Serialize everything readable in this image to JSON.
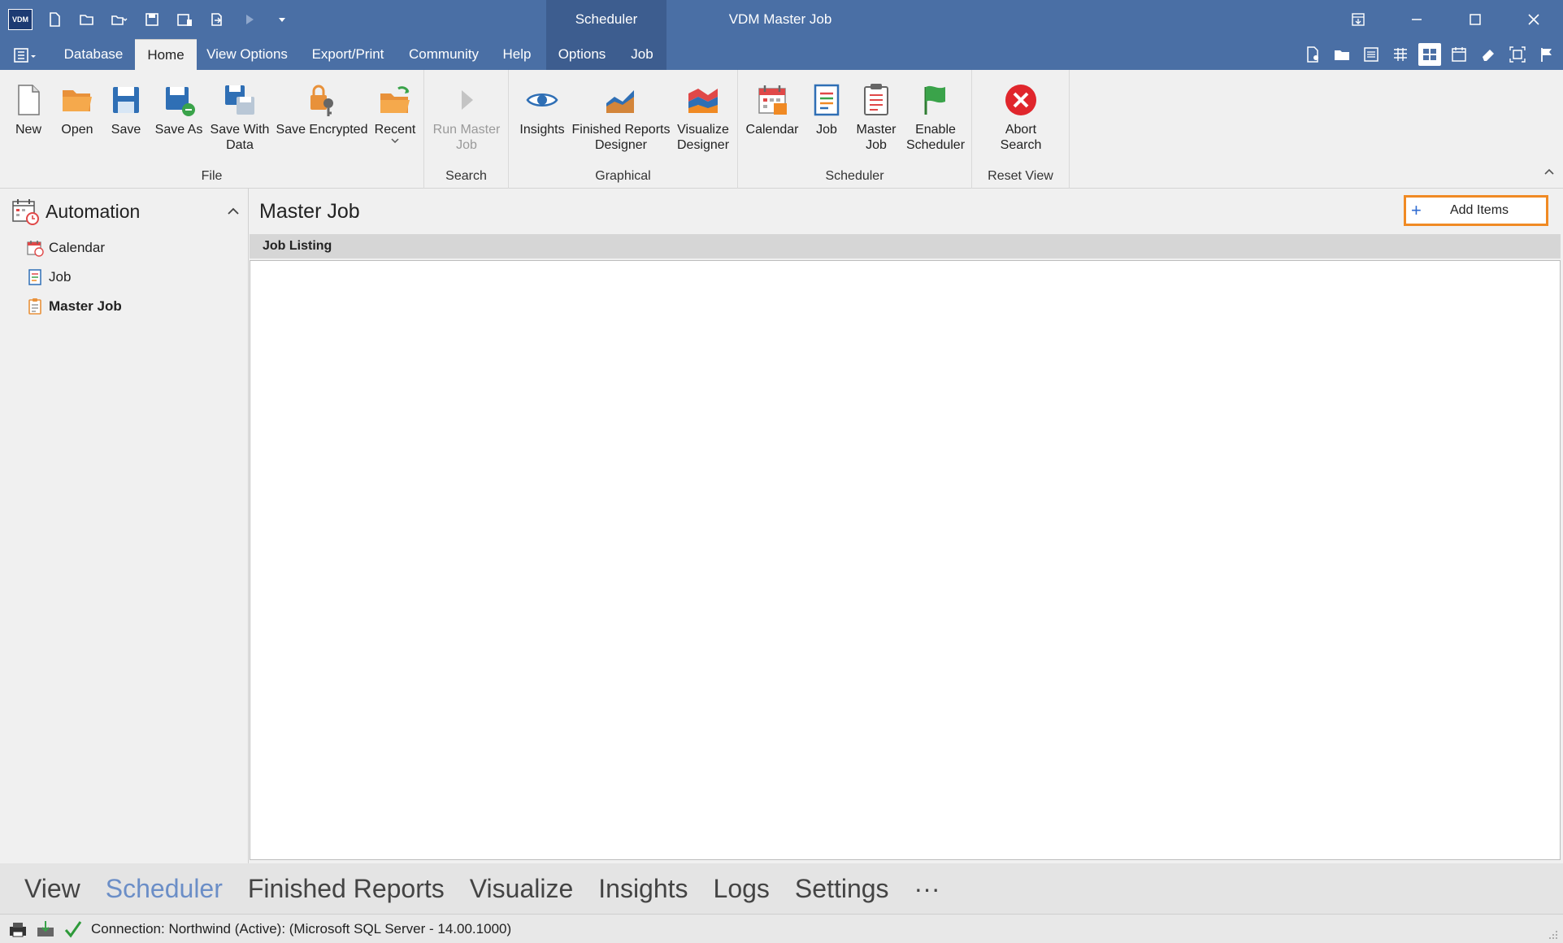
{
  "titlebar": {
    "logo_text": "VDM",
    "context_label": "Scheduler",
    "window_title": "VDM Master Job"
  },
  "tabs": [
    {
      "label": "Database"
    },
    {
      "label": "Home"
    },
    {
      "label": "View Options"
    },
    {
      "label": "Export/Print"
    },
    {
      "label": "Community"
    },
    {
      "label": "Help"
    },
    {
      "label": "Options"
    },
    {
      "label": "Job"
    }
  ],
  "ribbon": {
    "file": {
      "group_label": "File",
      "new": "New",
      "open": "Open",
      "save": "Save",
      "save_as": "Save As",
      "save_with_data": "Save With\nData",
      "save_encrypted": "Save Encrypted",
      "recent": "Recent"
    },
    "search": {
      "group_label": "Search",
      "run_master_job": "Run Master\nJob"
    },
    "graphical": {
      "group_label": "Graphical",
      "insights": "Insights",
      "finished_reports_designer": "Finished Reports\nDesigner",
      "visualize_designer": "Visualize\nDesigner"
    },
    "scheduler": {
      "group_label": "Scheduler",
      "calendar": "Calendar",
      "job": "Job",
      "master_job": "Master\nJob",
      "enable_scheduler": "Enable\nScheduler"
    },
    "reset_view": {
      "group_label": "Reset View",
      "abort_search": "Abort\nSearch"
    }
  },
  "sidebar": {
    "title": "Automation",
    "items": [
      {
        "label": "Calendar"
      },
      {
        "label": "Job"
      },
      {
        "label": "Master Job"
      }
    ]
  },
  "main": {
    "title": "Master Job",
    "add_items_label": "Add Items",
    "listing_header": "Job Listing"
  },
  "bottom_nav": [
    {
      "label": "View"
    },
    {
      "label": "Scheduler"
    },
    {
      "label": "Finished Reports"
    },
    {
      "label": "Visualize"
    },
    {
      "label": "Insights"
    },
    {
      "label": "Logs"
    },
    {
      "label": "Settings"
    },
    {
      "label": "···"
    }
  ],
  "status": {
    "connection_text": "Connection: Northwind (Active): (Microsoft SQL Server - 14.00.1000)"
  },
  "colors": {
    "titlebar": "#4a6fa5",
    "context_tab": "#3d5d8f",
    "highlight_border": "#f08a24",
    "active_bottom_nav": "#6b8ec7"
  }
}
